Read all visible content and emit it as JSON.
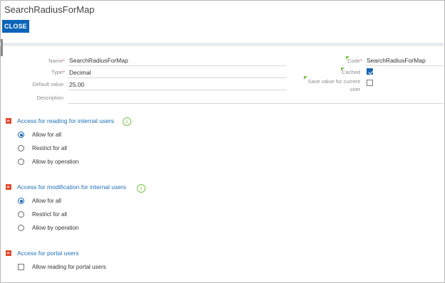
{
  "window": {
    "title": "SearchRadiusForMap"
  },
  "toolbar": {
    "close_label": "CLOSE"
  },
  "form": {
    "name_label": "Name",
    "name_value": "SearchRadiusForMap",
    "type_label": "Type",
    "type_value": "Decimal",
    "default_label": "Default value",
    "default_value": "25.00",
    "description_label": "Description",
    "description_value": "",
    "code_label": "Code",
    "code_value": "SearchRadiusForMap",
    "cached_label": "Cached",
    "cached_checked": true,
    "save_value_label": "Save value for current user",
    "save_value_checked": false,
    "required_mark": "*"
  },
  "sections": [
    {
      "title": "Access for reading for internal users",
      "info_icon": "i",
      "options": [
        {
          "label": "Allow for all",
          "selected": true
        },
        {
          "label": "Restrict for all",
          "selected": false
        },
        {
          "label": "Allow by operation",
          "selected": false
        }
      ]
    },
    {
      "title": "Access for modification for internal users",
      "info_icon": "i",
      "options": [
        {
          "label": "Allow for all",
          "selected": true
        },
        {
          "label": "Restrict for all",
          "selected": false
        },
        {
          "label": "Allow by operation",
          "selected": false
        }
      ]
    },
    {
      "title": "Access for portal users",
      "checkbox_label": "Allow reading for portal users",
      "checkbox_checked": false
    }
  ],
  "colors": {
    "accent": "#0b64b8",
    "section_toggle": "#e04a2f",
    "info": "#7ac143",
    "link": "#1e6fb8"
  }
}
